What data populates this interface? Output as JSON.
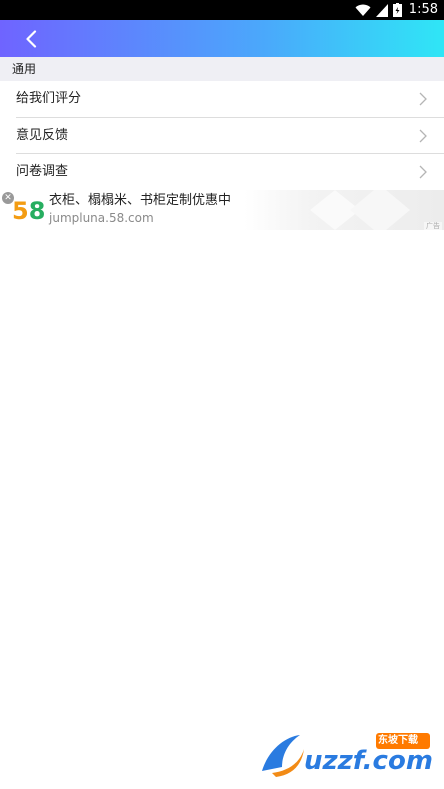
{
  "status_bar": {
    "time": "1:58",
    "icons": [
      "wifi-icon",
      "signal-icon",
      "battery-icon"
    ]
  },
  "app_bar": {
    "back_icon": "chevron-left-icon",
    "gradient": [
      "#6f64ff",
      "#4aa9fb",
      "#2fe6f6"
    ]
  },
  "section": {
    "title": "通用"
  },
  "menu_items": [
    {
      "label": "给我们评分"
    },
    {
      "label": "意见反馈"
    },
    {
      "label": "问卷调查"
    }
  ],
  "ad": {
    "logo": "58",
    "title": "衣柜、榻榻米、书柜定制优惠中",
    "url": "jumpluna.58.com",
    "tag": "广告"
  },
  "watermark": {
    "text": "uzzf.com",
    "badge": "东坡下载"
  }
}
